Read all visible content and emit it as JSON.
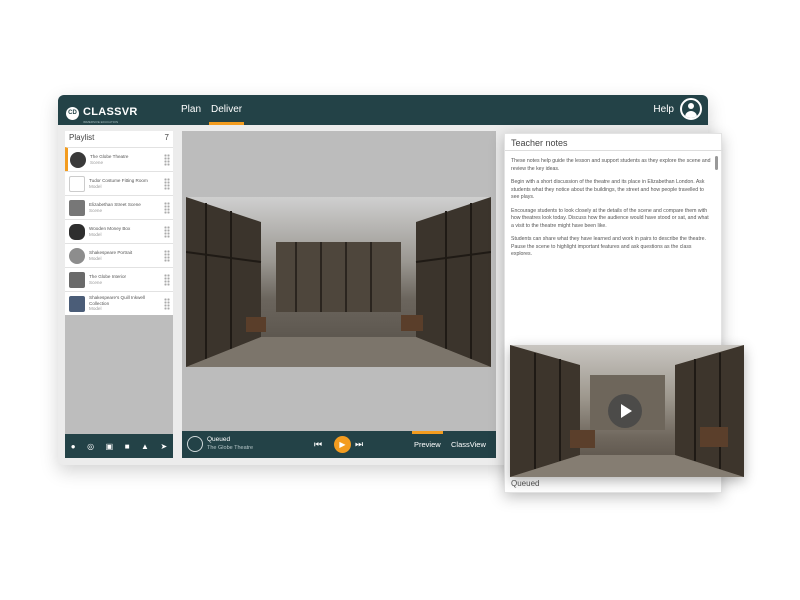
{
  "app": {
    "logo_mark": "CD",
    "logo_text": "CLASSVR",
    "logo_subtitle": "IMMERSIVE EDUCATION",
    "nav_plan": "Plan",
    "nav_deliver": "Deliver",
    "help": "Help",
    "accent_color": "#f39c1f",
    "primary_color": "#234247"
  },
  "sidebar": {
    "title": "Playlist",
    "count": "7",
    "items": [
      {
        "title": "The Globe Theatre",
        "sub": "Scene"
      },
      {
        "title": "Tudor Costume Fitting Room",
        "sub": "Model"
      },
      {
        "title": "Elizabethan Street Scene",
        "sub": "Scene"
      },
      {
        "title": "Wooden Money Box",
        "sub": "Model"
      },
      {
        "title": "Shakespeare Portrait",
        "sub": "Model"
      },
      {
        "title": "The Globe Interior",
        "sub": "Scene"
      },
      {
        "title": "Shakespeare's Quill Inkwell Collection",
        "sub": "Model"
      }
    ],
    "tools": [
      "person-icon",
      "headset-icon",
      "save-icon",
      "delete-icon",
      "person-icon",
      "send-icon"
    ]
  },
  "player": {
    "track_name": "Queued",
    "track_sub": "The Globe Theatre",
    "prev": "⏮",
    "play": "▶",
    "next": "⏭",
    "tab_preview": "Preview",
    "tab_classview": "ClassView"
  },
  "notes": {
    "title": "Teacher notes",
    "paragraphs": [
      "These notes help guide the lesson and support students as they explore the scene and review the key ideas.",
      "Begin with a short discussion of the theatre and its place in Elizabethan London. Ask students what they notice about the buildings, the street and how people travelled to see plays.",
      "Encourage students to look closely at the details of the scene and compare them with how theatres look today. Discuss how the audience would have stood or sat, and what a visit to the theatre might have been like.",
      "Students can share what they have learned and work in pairs to describe the theatre. Pause the scene to highlight important features and ask questions as the class explores."
    ],
    "clip_label": "Queued"
  }
}
